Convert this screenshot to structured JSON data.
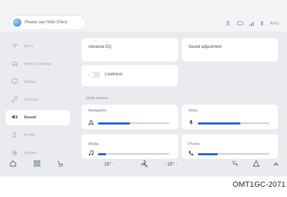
{
  "topbar": {
    "voice_prompt": "Please say Hello Chery",
    "status_time": "AVG"
  },
  "sidebar": {
    "items": [
      {
        "label": "Wi-Fi",
        "icon": "wifi-icon"
      },
      {
        "label": "Vehicle Settings",
        "icon": "car-icon"
      },
      {
        "label": "Display",
        "icon": "display-icon"
      },
      {
        "label": "Connect",
        "icon": "link-icon"
      },
      {
        "label": "Sound",
        "icon": "speaker-icon"
      },
      {
        "label": "Profile",
        "icon": "person-icon"
      },
      {
        "label": "System",
        "icon": "gear-icon"
      }
    ],
    "active_index": 4
  },
  "sound": {
    "advanced_eq": "Advance EQ",
    "sound_adjustment": "Sound adjustment",
    "loudness": "Loudness",
    "loudness_on": false,
    "volume_section": "Multi volume",
    "sliders": [
      {
        "label": "Navigation",
        "icon": "navigation-icon",
        "level": 0.45
      },
      {
        "label": "Voice",
        "icon": "microphone-icon",
        "level": 0.6
      },
      {
        "label": "Media",
        "icon": "music-icon",
        "level": 0.12
      },
      {
        "label": "Phone",
        "icon": "phone-icon",
        "level": 0.28
      }
    ]
  },
  "bottombar": {
    "left_temp": "16",
    "right_temp": "16"
  },
  "caption": "OMT1GC-2071",
  "colors": {
    "accent": "#1f5fd0",
    "background": "#e9ebef",
    "card": "#ffffff"
  }
}
